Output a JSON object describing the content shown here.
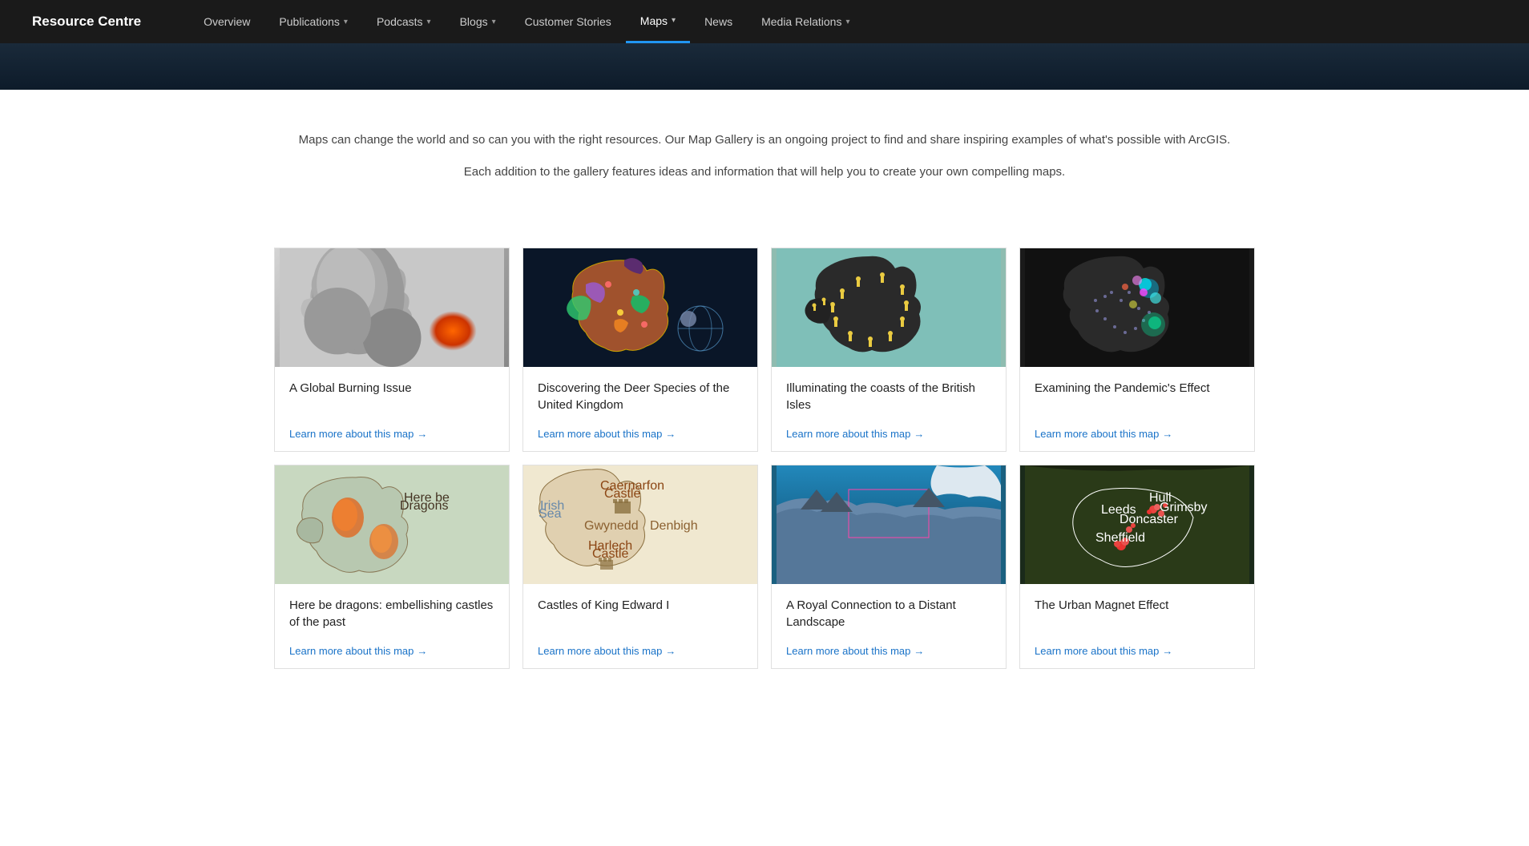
{
  "brand": "Resource Centre",
  "nav": {
    "items": [
      {
        "label": "Overview",
        "hasDropdown": false,
        "active": false
      },
      {
        "label": "Publications",
        "hasDropdown": true,
        "active": false
      },
      {
        "label": "Podcasts",
        "hasDropdown": true,
        "active": false
      },
      {
        "label": "Blogs",
        "hasDropdown": true,
        "active": false
      },
      {
        "label": "Customer Stories",
        "hasDropdown": false,
        "active": false
      },
      {
        "label": "Maps",
        "hasDropdown": true,
        "active": true
      },
      {
        "label": "News",
        "hasDropdown": false,
        "active": false
      },
      {
        "label": "Media Relations",
        "hasDropdown": true,
        "active": false
      }
    ]
  },
  "intro": {
    "line1": "Maps can change the world and so can you with the right resources. Our Map Gallery is an ongoing project to find and share inspiring examples of what's possible with ArcGIS.",
    "line2": "Each addition to the gallery features ideas and information that will help you to create your own compelling maps."
  },
  "maps": [
    {
      "title": "A Global Burning Issue",
      "learnMore": "Learn more about this map",
      "imageType": "burning"
    },
    {
      "title": "Discovering the Deer Species of the United Kingdom",
      "learnMore": "Learn more about this map",
      "imageType": "deer"
    },
    {
      "title": "Illuminating the coasts of the British Isles",
      "learnMore": "Learn more about this map",
      "imageType": "coasts"
    },
    {
      "title": "Examining the Pandemic's Effect",
      "learnMore": "Learn more about this map",
      "imageType": "pandemic"
    },
    {
      "title": "Here be dragons: embellishing castles of the past",
      "learnMore": "Learn more about this map",
      "imageType": "dragons"
    },
    {
      "title": "Castles of King Edward I",
      "learnMore": "Learn more about this map",
      "imageType": "castles"
    },
    {
      "title": "A Royal Connection to a Distant Landscape",
      "learnMore": "Learn more about this map",
      "imageType": "royal"
    },
    {
      "title": "The Urban Magnet Effect",
      "learnMore": "Learn more about this map",
      "imageType": "urban"
    }
  ],
  "arrow": "→"
}
